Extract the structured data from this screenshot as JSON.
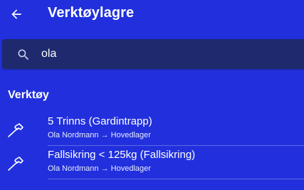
{
  "appbar": {
    "title": "Verktøylagre",
    "back_icon": "arrow-left-icon"
  },
  "search": {
    "icon": "search-icon",
    "value": "ola"
  },
  "section": {
    "title": "Verktøy"
  },
  "tools": [
    {
      "name": "5 Trinns (Gardintrapp)",
      "subtitle": "Ola Nordmann → Hovedlager",
      "icon": "hammer-icon"
    },
    {
      "name": "Fallsikring < 125kg (Fallsikring)",
      "subtitle": "Ola Nordmann → Hovedlager",
      "icon": "hammer-icon"
    }
  ],
  "colors": {
    "background": "#2130dc",
    "search_bar": "#1f2a6e",
    "text": "#ffffff"
  }
}
